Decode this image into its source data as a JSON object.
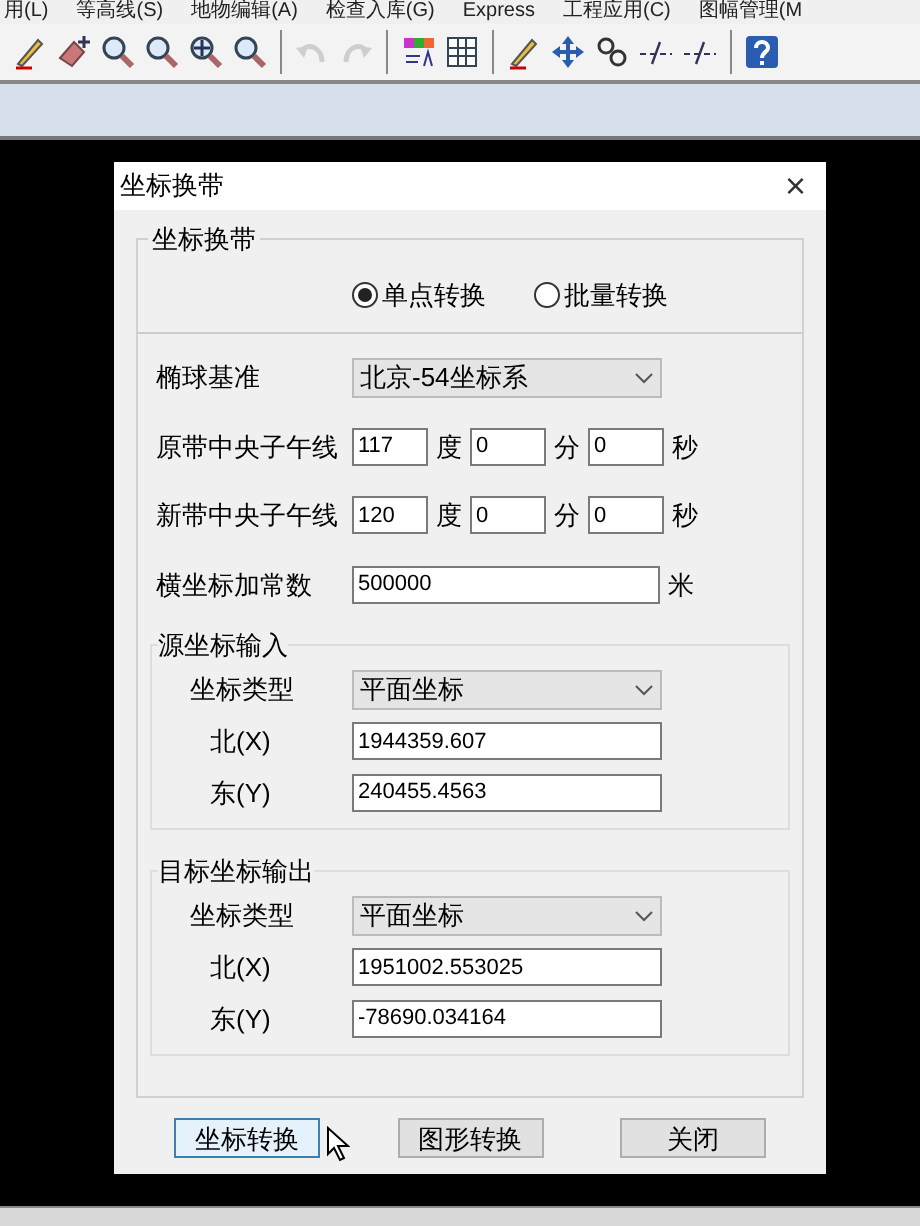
{
  "menu": [
    "用(L)",
    "等高线(S)",
    "地物编辑(A)",
    "检查入库(G)",
    "Express",
    "工程应用(C)",
    "图幅管理(M"
  ],
  "toolbar": [
    [
      {
        "kind": "pencil",
        "disabled": false
      },
      {
        "kind": "edit",
        "disabled": false
      },
      {
        "kind": "zoom",
        "disabled": false
      },
      {
        "kind": "zoom",
        "disabled": false
      },
      {
        "kind": "pan",
        "disabled": false
      },
      {
        "kind": "zoom",
        "disabled": false
      }
    ],
    [
      {
        "kind": "undo",
        "disabled": true
      },
      {
        "kind": "redo",
        "disabled": true
      }
    ],
    [
      {
        "kind": "palette",
        "disabled": false
      },
      {
        "kind": "grid",
        "disabled": false
      }
    ],
    [
      {
        "kind": "pencil",
        "disabled": false
      },
      {
        "kind": "move",
        "disabled": false
      },
      {
        "kind": "link",
        "disabled": false
      },
      {
        "kind": "line",
        "disabled": false
      },
      {
        "kind": "line",
        "disabled": false
      }
    ],
    [
      {
        "kind": "help",
        "disabled": false
      }
    ]
  ],
  "dialog": {
    "title": "坐标换带",
    "close": "×",
    "group": {
      "title": "坐标换带",
      "modes": [
        {
          "label": "单点转换",
          "selected": true
        },
        {
          "label": "批量转换",
          "selected": false
        }
      ],
      "ellipsoid": {
        "label": "椭球基准",
        "value": "北京-54坐标系"
      },
      "meridians": [
        {
          "label": "原带中央子午线",
          "deg": "117",
          "deg_unit": "度",
          "min": "0",
          "min_unit": "分",
          "sec": "0",
          "sec_unit": "秒"
        },
        {
          "label": "新带中央子午线",
          "deg": "120",
          "deg_unit": "度",
          "min": "0",
          "min_unit": "分",
          "sec": "0",
          "sec_unit": "秒"
        }
      ],
      "offset": {
        "label": "横坐标加常数",
        "value": "500000",
        "unit": "米"
      },
      "sections": [
        {
          "title": "源坐标输入",
          "type_label": "坐标类型",
          "type_value": "平面坐标",
          "north_label": "北(X)",
          "north": "1944359.607",
          "east_label": "东(Y)",
          "east": "240455.4563"
        },
        {
          "title": "目标坐标输出",
          "type_label": "坐标类型",
          "type_value": "平面坐标",
          "north_label": "北(X)",
          "north": "1951002.553025",
          "east_label": "东(Y)",
          "east": "-78690.034164"
        }
      ]
    },
    "buttons": [
      {
        "label": "坐标转换",
        "focused": true
      },
      {
        "label": "图形转换",
        "focused": false
      },
      {
        "label": "关闭",
        "focused": false
      }
    ]
  }
}
